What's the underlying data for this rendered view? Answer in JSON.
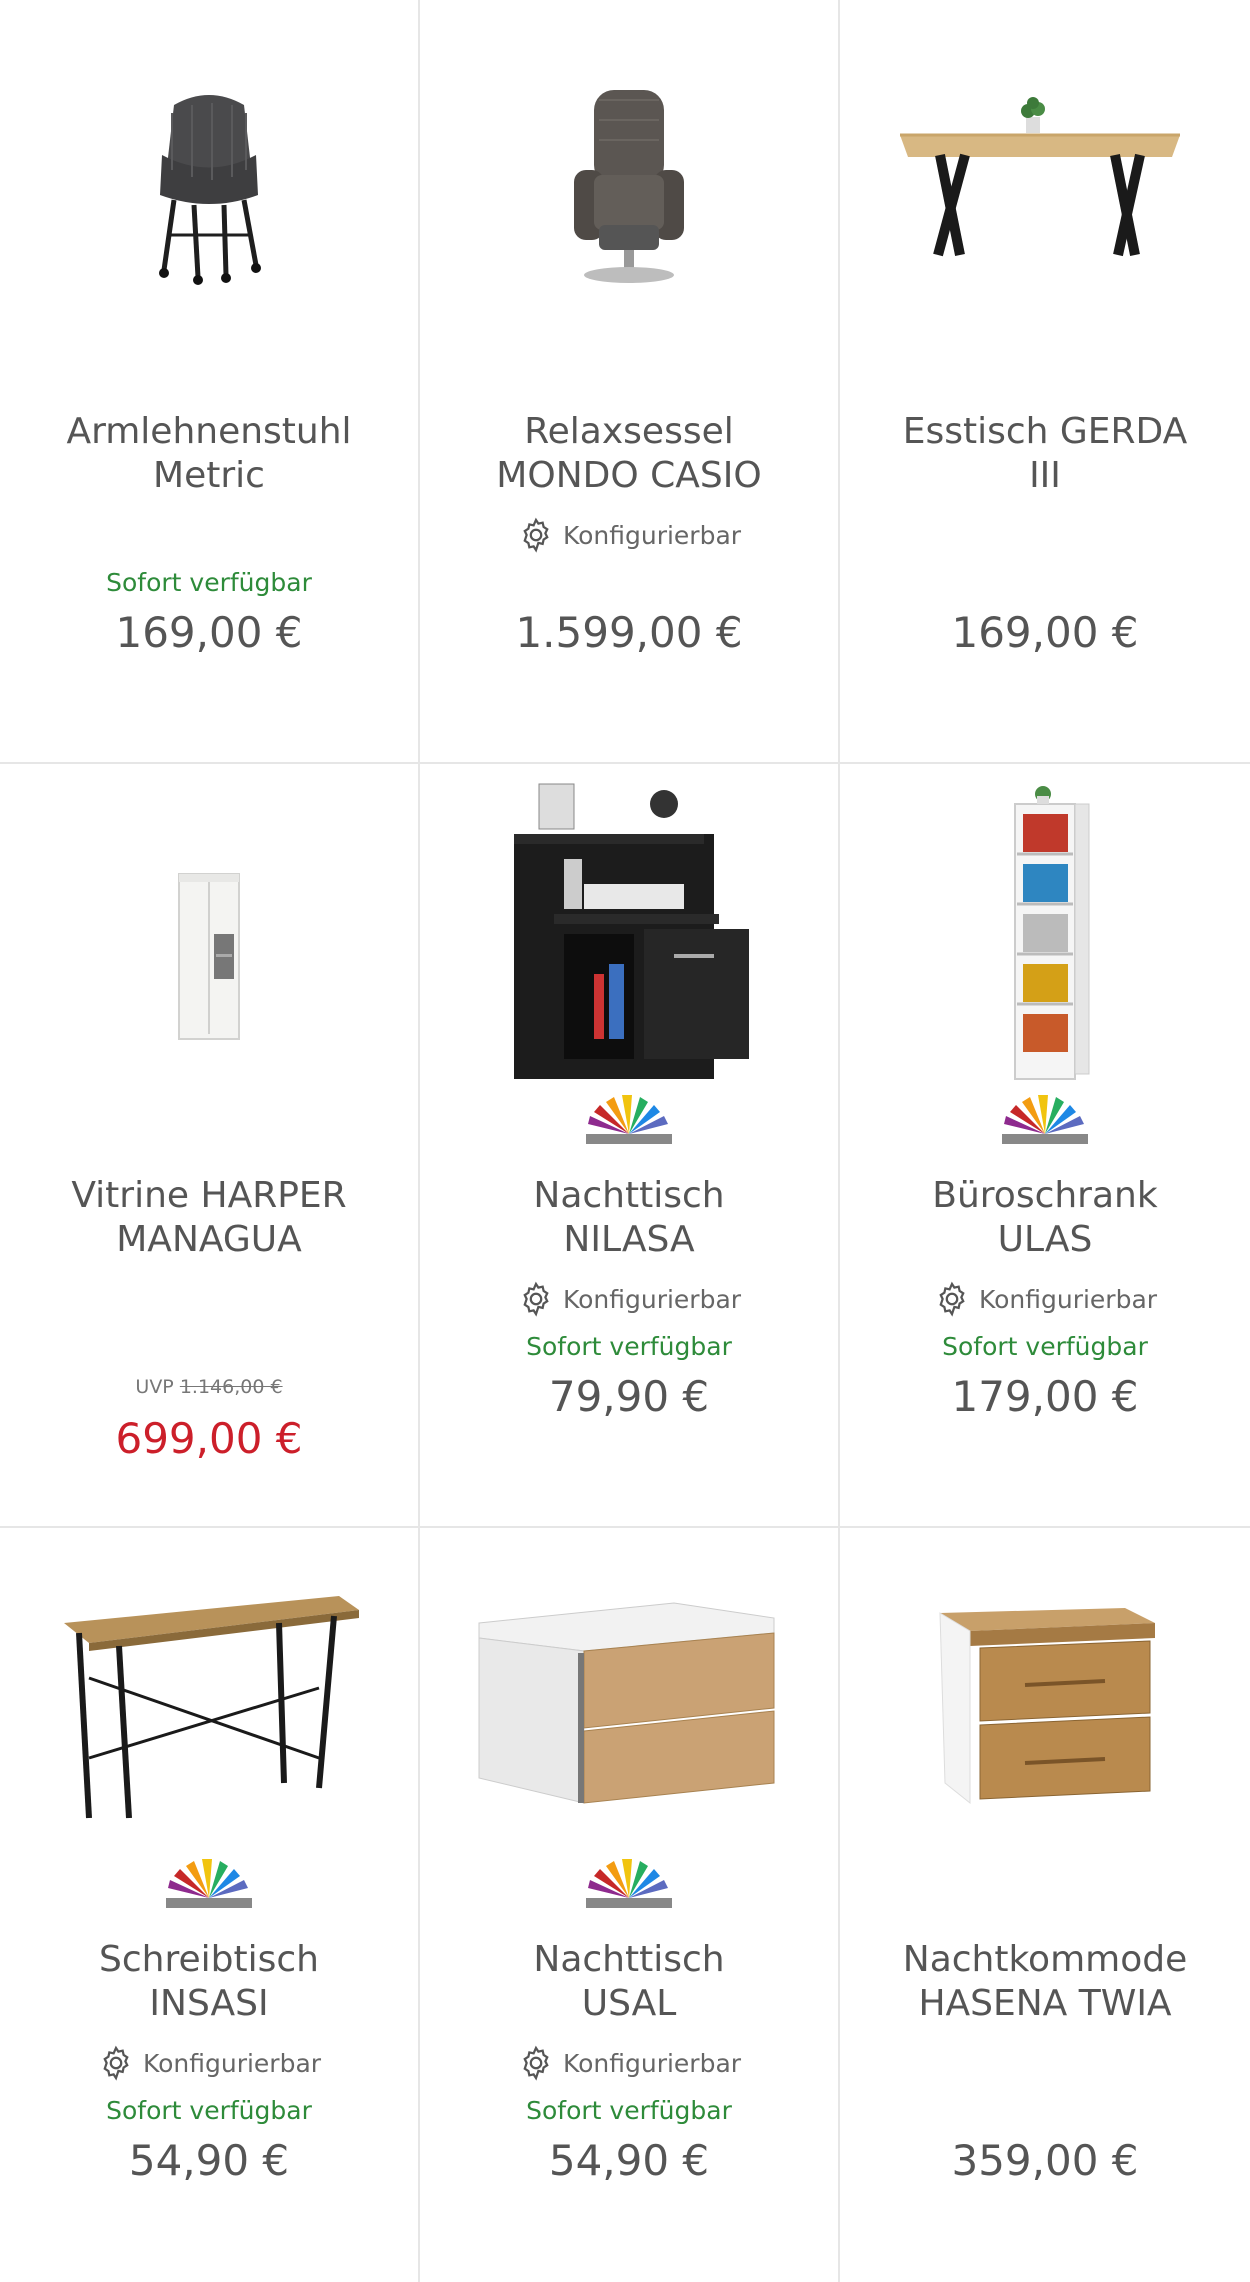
{
  "colors": {
    "text": "#555555",
    "availability": "#2e8b3a",
    "sale_price": "#cc1f2a",
    "divider": "#e6e6e6"
  },
  "products": [
    {
      "title_line1": "Armlehnenstuhl",
      "title_line2": "Metric",
      "configurable": "",
      "availability": "Sofort verfügbar",
      "uvp_label": "",
      "uvp_price": "",
      "price": "169,00 €",
      "image_icon": "armchair-image"
    },
    {
      "title_line1": "Relaxsessel",
      "title_line2": "MONDO CASIO",
      "configurable": "Konfigurierbar",
      "availability": "",
      "uvp_label": "",
      "uvp_price": "",
      "price": "1.599,00 €",
      "image_icon": "recliner-image"
    },
    {
      "title_line1": "Esstisch GERDA",
      "title_line2": "III",
      "configurable": "",
      "availability": "",
      "uvp_label": "",
      "uvp_price": "",
      "price": "169,00 €",
      "image_icon": "dining-table-image"
    },
    {
      "title_line1": "Vitrine HARPER",
      "title_line2": "MANAGUA",
      "configurable": "",
      "availability": "",
      "uvp_label": "UVP",
      "uvp_price": "1.146,00 €",
      "price": "699,00 €",
      "image_icon": "vitrine-image"
    },
    {
      "title_line1": "Nachttisch",
      "title_line2": "NILASA",
      "configurable": "Konfigurierbar",
      "availability": "Sofort verfügbar",
      "uvp_label": "",
      "uvp_price": "",
      "price": "79,90 €",
      "image_icon": "nightstand-black-image"
    },
    {
      "title_line1": "Büroschrank",
      "title_line2": "ULAS",
      "configurable": "Konfigurierbar",
      "availability": "Sofort verfügbar",
      "uvp_label": "",
      "uvp_price": "",
      "price": "179,00 €",
      "image_icon": "office-cabinet-image"
    },
    {
      "title_line1": "Schreibtisch",
      "title_line2": "INSASI",
      "configurable": "Konfigurierbar",
      "availability": "Sofort verfügbar",
      "uvp_label": "",
      "uvp_price": "",
      "price": "54,90 €",
      "image_icon": "desk-image"
    },
    {
      "title_line1": "Nachttisch",
      "title_line2": "USAL",
      "configurable": "Konfigurierbar",
      "availability": "Sofort verfügbar",
      "uvp_label": "",
      "uvp_price": "",
      "price": "54,90 €",
      "image_icon": "nightstand-white-oak-image"
    },
    {
      "title_line1": "Nachtkommode",
      "title_line2": "HASENA TWIA",
      "configurable": "",
      "availability": "",
      "uvp_label": "",
      "uvp_price": "",
      "price": "359,00 €",
      "image_icon": "bedside-chest-image"
    }
  ]
}
